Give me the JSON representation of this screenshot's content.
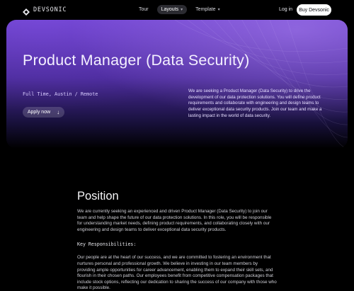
{
  "brand": {
    "name": "DEVSONIC"
  },
  "nav": {
    "items": [
      {
        "label": "Tour"
      },
      {
        "label": "Layouts"
      },
      {
        "label": "Template"
      }
    ],
    "login_label": "Log in",
    "buy_label": "Buy Devsonic"
  },
  "hero": {
    "title": "Product Manager (Data Security)",
    "meta": "Full Time, Austin / Remote",
    "apply_label": "Apply now",
    "description": "We are seeking a Product Manager (Data Security) to drive the development of our data protection solutions. You will define product requirements and collaborate with engineering and design teams to deliver exceptional data security products. Join our team and make a lasting impact in the world of data security."
  },
  "position": {
    "heading": "Position",
    "intro": "We are currently seeking an experienced and driven Product Manager (Data Security) to join our team and help shape the future of our data protection solutions. In this role, you will be responsible for understanding market needs, defining product requirements, and collaborating closely with our engineering and design teams to deliver exceptional data security products.",
    "responsibilities_heading": "Key Responsibilities:",
    "body": "Our people are at the heart of our success, and we are committed to fostering an environment that nurtures personal and professional growth. We believe in investing in our team members by providing ample opportunities for career advancement, enabling them to expand their skill sets, and flourish in their chosen paths. Our employees benefit from competitive compensation packages that include stock options, reflecting our dedication to sharing the success of our company with those who make it possible."
  },
  "colors": {
    "accent": "#6b3fc9",
    "background": "#000000"
  }
}
